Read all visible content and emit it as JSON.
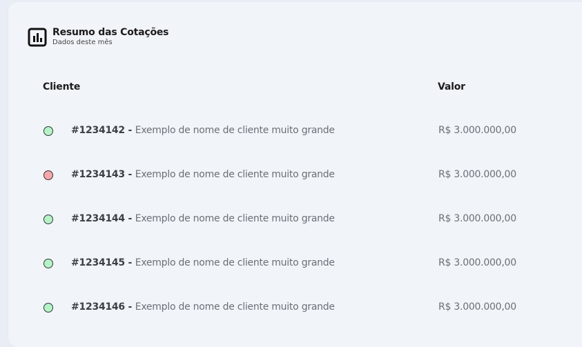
{
  "summary": {
    "title": "Resumo das Cotações",
    "subtitle": "Dados deste mês",
    "icon": "bar-chart-icon"
  },
  "table": {
    "columns": [
      "Cliente",
      "Valor"
    ],
    "rows": [
      {
        "status": "success",
        "status_color": "#b6f2c8",
        "id": "#1234142",
        "separator": " - ",
        "name": "Exemplo de nome de cliente muito grande",
        "value": "R$ 3.000.000,00"
      },
      {
        "status": "error",
        "status_color": "#f4a8ae",
        "id": "#1234143",
        "separator": " - ",
        "name": "Exemplo de nome de cliente muito grande",
        "value": "R$ 3.000.000,00"
      },
      {
        "status": "success",
        "status_color": "#b6f2c8",
        "id": "#1234144",
        "separator": " - ",
        "name": "Exemplo de nome de cliente muito grande",
        "value": "R$ 3.000.000,00"
      },
      {
        "status": "success",
        "status_color": "#b6f2c8",
        "id": "#1234145",
        "separator": " - ",
        "name": "Exemplo de nome de cliente muito grande",
        "value": "R$ 3.000.000,00"
      },
      {
        "status": "success",
        "status_color": "#b6f2c8",
        "id": "#1234146",
        "separator": " - ",
        "name": "Exemplo de nome de cliente muito grande",
        "value": "R$ 3.000.000,00"
      }
    ]
  }
}
